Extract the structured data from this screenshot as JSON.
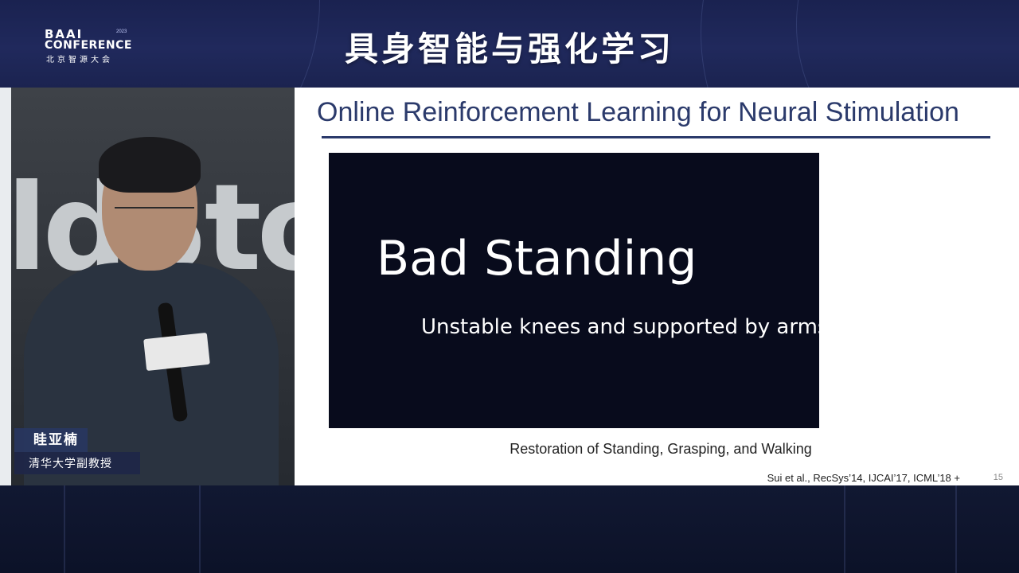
{
  "banner": {
    "logo_line1": "BAAI",
    "logo_year": "2023",
    "logo_line2": "CONFERENCE",
    "logo_line3": "北京智源大会",
    "session_title": "具身智能与强化学习"
  },
  "speaker": {
    "name": "眭亚楠",
    "title": "清华大学副教授"
  },
  "slide": {
    "title": "Online Reinforcement Learning for Neural Stimulation",
    "video_main_text": "Bad Standing",
    "video_sub_text": "Unstable knees and supported by arms",
    "caption": "Restoration of Standing, Grasping, and Walking",
    "citation": "Sui et al., RecSys’14, IJCAI’17, ICML’18 +",
    "page_number": "15"
  },
  "colors": {
    "banner_bg": "#20295c",
    "slide_title": "#2b3a6b",
    "video_bg": "#080b1c",
    "name_box": "#283660"
  }
}
